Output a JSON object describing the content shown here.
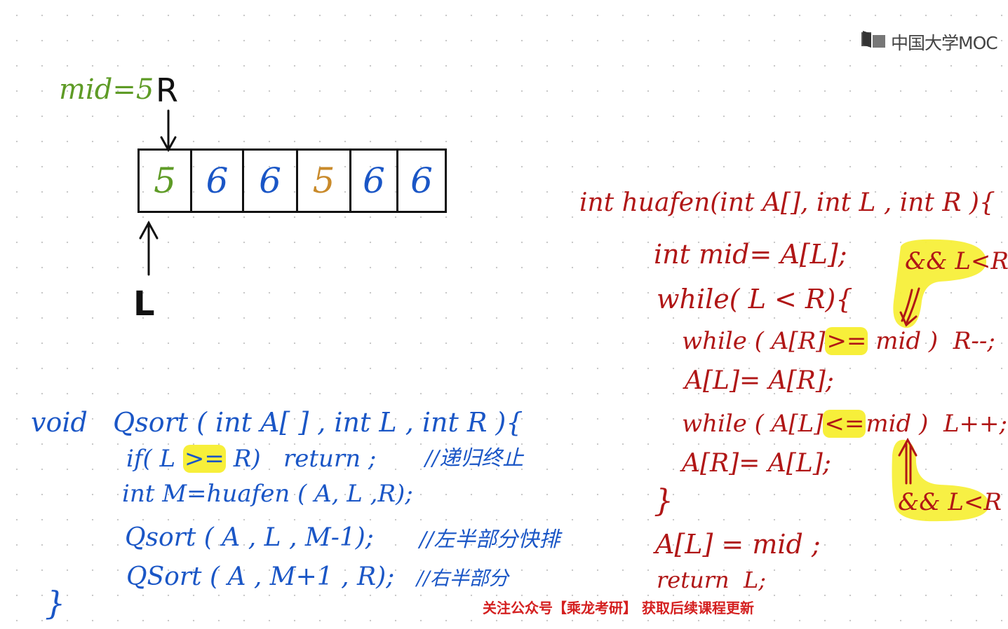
{
  "logo": {
    "text": "中国大学MOC"
  },
  "diagram": {
    "mid_label": "mid=5",
    "r_label": "R",
    "l_label": "L",
    "cells": [
      {
        "value": "5",
        "color": "#5e9b26"
      },
      {
        "value": "6",
        "color": "#1a56c6"
      },
      {
        "value": "6",
        "color": "#1a56c6"
      },
      {
        "value": "5",
        "color": "#c98a2a"
      },
      {
        "value": "6",
        "color": "#1a56c6"
      },
      {
        "value": "6",
        "color": "#1a56c6"
      }
    ]
  },
  "huafen": {
    "line1": "int huafen(int A[], int L , int R ){",
    "line2": "int mid= A[L];",
    "line3": "while( L < R){",
    "line4a": "while ( A[R]",
    "line4hl": ">=",
    "line4b": " mid )  R--;",
    "line5": "A[L]= A[R];",
    "line6a": "while ( A[L]",
    "line6hl": "<=",
    "line6b": "mid )  L++;",
    "line7": "A[R]= A[L];",
    "line8": "}",
    "line9": "A[L] = mid ;",
    "line10": "return  L;",
    "note1": "&& L<R",
    "note2": "&& L<R"
  },
  "qsort": {
    "line1": "void   Qsort ( int A[ ] , int L , int R ){",
    "line2a": "if( L ",
    "line2hl": ">=",
    "line2b": " R)   return ;",
    "line2c": "//递归终止",
    "line3": "int M=huafen ( A, L ,R);",
    "line4": "Qsort ( A , L , M-1);",
    "line4c": "//左半部分快排",
    "line5": "QSort ( A , M+1 , R);",
    "line5c": "//右半部分",
    "line6": "}"
  },
  "banner": {
    "text": "关注公众号【乘龙考研】 获取后续课程更新"
  },
  "colors": {
    "green": "#5e9b26",
    "blue": "#1a56c6",
    "red": "#b01616",
    "highlight": "#f7ef3a",
    "banner": "#d42020"
  }
}
